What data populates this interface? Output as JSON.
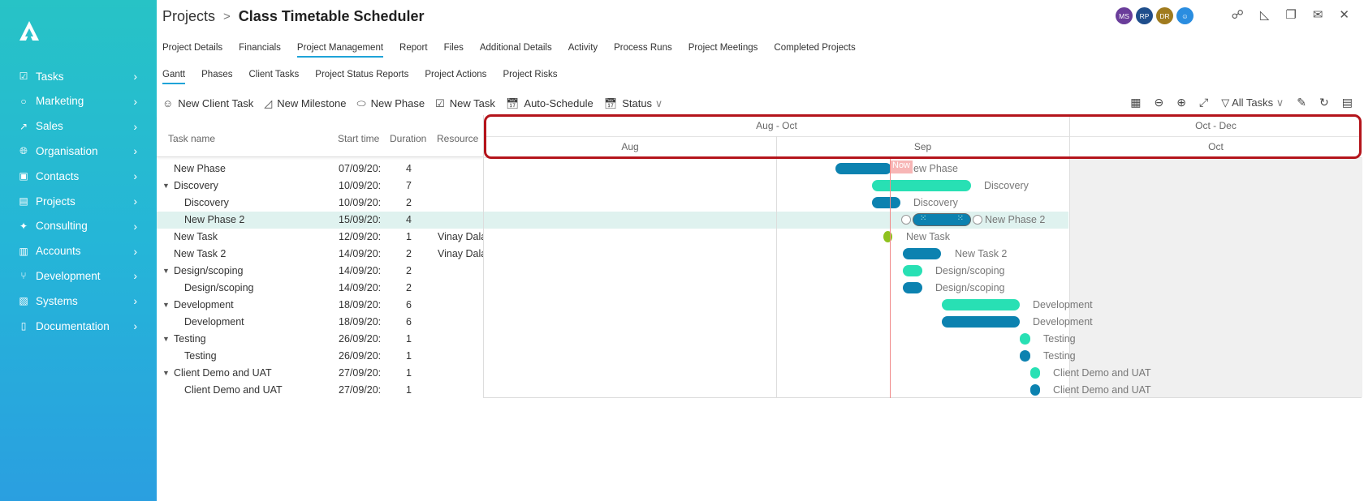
{
  "header": {
    "breadcrumb": "Projects",
    "title": "Class Timetable Scheduler",
    "avatars": [
      {
        "initials": "MS",
        "color": "#6a3d9a"
      },
      {
        "initials": "RP",
        "color": "#1f4e8c"
      },
      {
        "initials": "DR",
        "color": "#a07b1e"
      },
      {
        "initials": "",
        "color": "#2a8de0",
        "icon": "user-icon"
      }
    ],
    "icons": [
      "workflow-icon",
      "ruler-icon",
      "copy-icon",
      "mail-icon",
      "close-icon"
    ]
  },
  "sidebar": {
    "items": [
      {
        "label": "Tasks",
        "icon": "clipboard-icon"
      },
      {
        "label": "Marketing",
        "icon": "circle-icon"
      },
      {
        "label": "Sales",
        "icon": "chart-icon"
      },
      {
        "label": "Organisation",
        "icon": "globe-icon"
      },
      {
        "label": "Contacts",
        "icon": "contact-card-icon"
      },
      {
        "label": "Projects",
        "icon": "projects-icon"
      },
      {
        "label": "Consulting",
        "icon": "consulting-icon"
      },
      {
        "label": "Accounts",
        "icon": "money-icon"
      },
      {
        "label": "Development",
        "icon": "branch-icon"
      },
      {
        "label": "Systems",
        "icon": "systems-icon"
      },
      {
        "label": "Documentation",
        "icon": "book-icon"
      }
    ]
  },
  "tabs": [
    "Project Details",
    "Financials",
    "Project Management",
    "Report",
    "Files",
    "Additional Details",
    "Activity",
    "Process Runs",
    "Project Meetings",
    "Completed Projects"
  ],
  "active_tab": "Project Management",
  "subtabs": [
    "Gantt",
    "Phases",
    "Client Tasks",
    "Project Status Reports",
    "Project Actions",
    "Project Risks"
  ],
  "active_subtab": "Gantt",
  "toolbar": {
    "new_client_task": "New Client Task",
    "new_milestone": "New Milestone",
    "new_phase": "New Phase",
    "new_task": "New Task",
    "auto_schedule": "Auto-Schedule",
    "status": "Status",
    "filter": "All Tasks"
  },
  "grid": {
    "columns": [
      "Task name",
      "Start time",
      "Duration",
      "Resource"
    ],
    "rows": [
      {
        "name": "New Phase",
        "start": "07/09/20:",
        "duration": "4",
        "resource": "",
        "level": 0,
        "expand": false
      },
      {
        "name": "Discovery",
        "start": "10/09/20:",
        "duration": "7",
        "resource": "",
        "level": 0,
        "expand": true
      },
      {
        "name": "Discovery",
        "start": "10/09/20:",
        "duration": "2",
        "resource": "",
        "level": 1,
        "expand": false
      },
      {
        "name": "New Phase 2",
        "start": "15/09/20:",
        "duration": "4",
        "resource": "",
        "level": 1,
        "expand": false,
        "selected": true
      },
      {
        "name": "New Task",
        "start": "12/09/20:",
        "duration": "1",
        "resource": "Vinay Dala",
        "level": 0,
        "expand": false
      },
      {
        "name": "New Task 2",
        "start": "14/09/20:",
        "duration": "2",
        "resource": "Vinay Dala",
        "level": 0,
        "expand": false
      },
      {
        "name": "Design/scoping",
        "start": "14/09/20:",
        "duration": "2",
        "resource": "",
        "level": 0,
        "expand": true
      },
      {
        "name": "Design/scoping",
        "start": "14/09/20:",
        "duration": "2",
        "resource": "",
        "level": 1,
        "expand": false
      },
      {
        "name": "Development",
        "start": "18/09/20:",
        "duration": "6",
        "resource": "",
        "level": 0,
        "expand": true
      },
      {
        "name": "Development",
        "start": "18/09/20:",
        "duration": "6",
        "resource": "",
        "level": 1,
        "expand": false
      },
      {
        "name": "Testing",
        "start": "26/09/20:",
        "duration": "1",
        "resource": "",
        "level": 0,
        "expand": true
      },
      {
        "name": "Testing",
        "start": "26/09/20:",
        "duration": "1",
        "resource": "",
        "level": 1,
        "expand": false
      },
      {
        "name": "Client Demo and UAT",
        "start": "27/09/20:",
        "duration": "1",
        "resource": "",
        "level": 0,
        "expand": true
      },
      {
        "name": "Client Demo and UAT",
        "start": "27/09/20:",
        "duration": "1",
        "resource": "",
        "level": 1,
        "expand": false
      }
    ]
  },
  "timeline": {
    "quarters": [
      "Aug - Oct",
      "Oct - Dec"
    ],
    "months": [
      "Aug",
      "Sep",
      "Oct"
    ],
    "today_label": "Now"
  },
  "colors": {
    "task": "#0c82b0",
    "summary": "#28e0b4",
    "milestone": "#8fc21f",
    "today": "#f08a8a",
    "highlight": "#b4141b"
  }
}
